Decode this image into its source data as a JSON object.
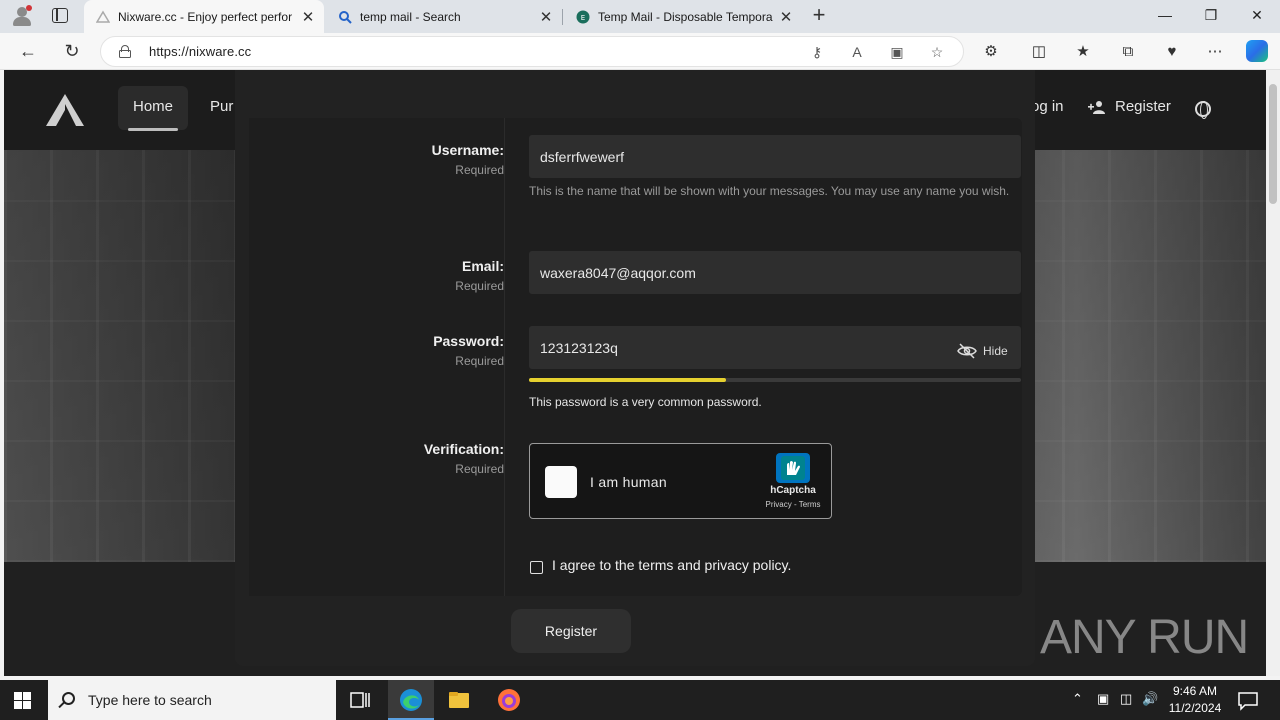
{
  "browser": {
    "tabs": [
      {
        "title": "Nixware.cc - Enjoy perfect perfor",
        "active": true
      },
      {
        "title": "temp mail - Search",
        "active": false
      },
      {
        "title": "Temp Mail - Disposable Tempora",
        "active": false
      }
    ],
    "url": "https://nixware.cc"
  },
  "site": {
    "nav_home": "Home",
    "nav_purchase": "Pur",
    "nav_login": "og in",
    "nav_register": "Register"
  },
  "form": {
    "username": {
      "label": "Username:",
      "required": "Required",
      "value": "dsferrfwewerf",
      "hint": "This is the name that will be shown with your messages. You may use any name you wish."
    },
    "email": {
      "label": "Email:",
      "required": "Required",
      "value": "waxera8047@aqqor.com"
    },
    "password": {
      "label": "Password:",
      "required": "Required",
      "value": "123123123q",
      "hide_label": "Hide",
      "strength": 0.4,
      "strength_color": "#e5d02f",
      "strength_message": "This password is a very common password."
    },
    "verification": {
      "label": "Verification:",
      "required": "Required",
      "captcha_text": "I am human",
      "captcha_brand": "hCaptcha",
      "captcha_links": "Privacy - Terms"
    },
    "agree_text": "I agree to the terms and privacy policy.",
    "register_button": "Register"
  },
  "watermark": "ANY RUN",
  "taskbar": {
    "search_placeholder": "Type here to search",
    "time": "9:46 AM",
    "date": "11/2/2024"
  }
}
